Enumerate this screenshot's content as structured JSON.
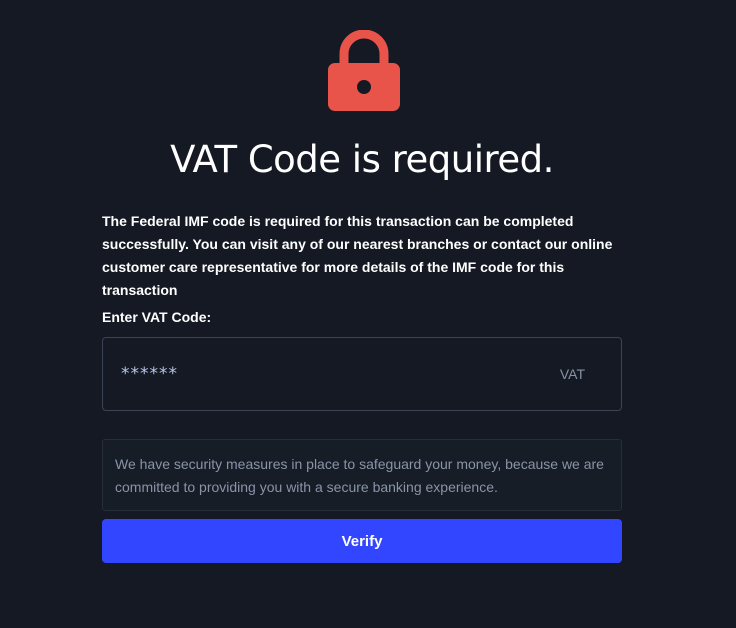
{
  "header": {
    "icon": "lock-icon",
    "icon_color": "#e8544a",
    "title": "VAT Code is required."
  },
  "description": "The Federal IMF code is required for this transaction can be completed successfully. You can visit any of our nearest branches or contact our online customer care representative for more details of the IMF code for this transaction",
  "form": {
    "label": "Enter VAT Code:",
    "input_value": "******",
    "input_suffix": "VAT"
  },
  "notice": {
    "text": "We have security measures in place to safeguard your money, because we are committed to providing you with a secure banking experience."
  },
  "actions": {
    "verify_label": "Verify",
    "button_color": "#3346ff"
  }
}
